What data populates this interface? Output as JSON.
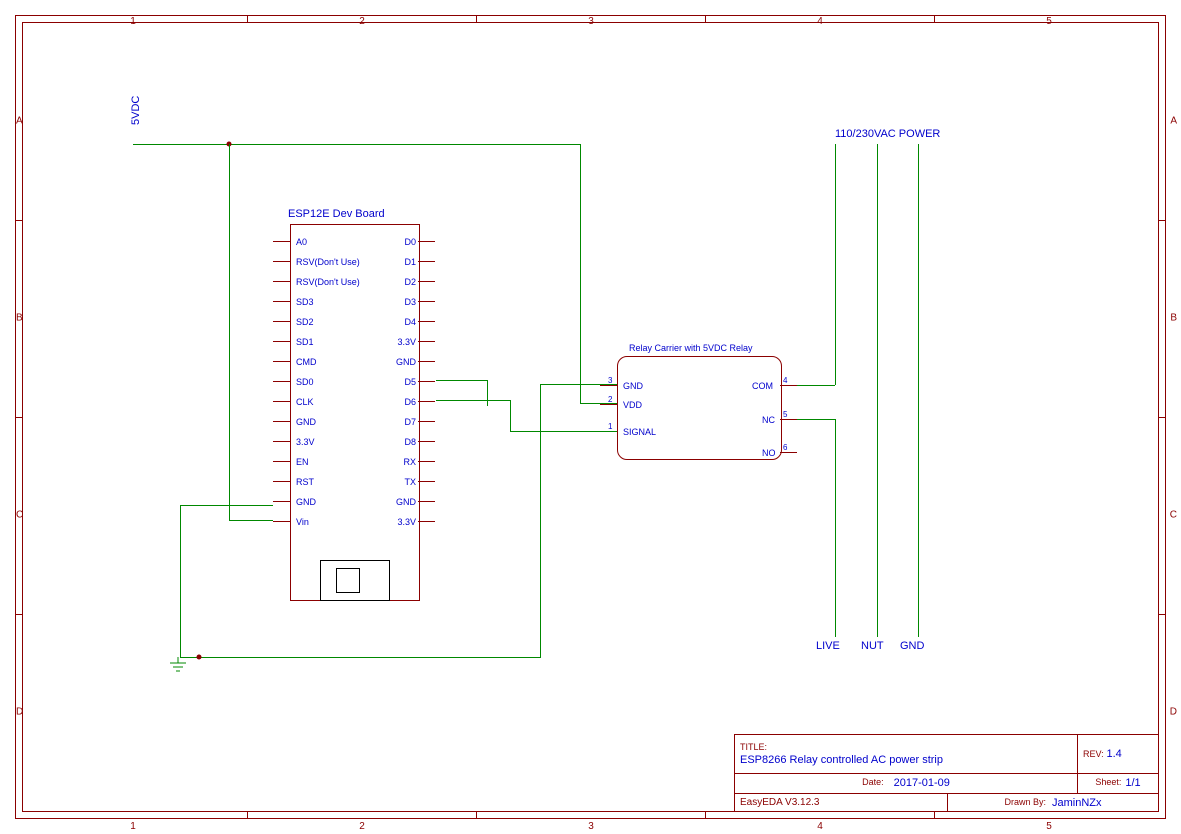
{
  "domain": "Diagram",
  "frame": {
    "cols": [
      "1",
      "2",
      "3",
      "4",
      "5"
    ],
    "rows": [
      "A",
      "B",
      "C",
      "D"
    ]
  },
  "titleblock": {
    "title_label": "TITLE:",
    "title": "ESP8266 Relay controlled AC power strip",
    "rev_label": "REV:",
    "rev": "1.4",
    "date_label": "Date:",
    "date": "2017-01-09",
    "sheet_label": "Sheet:",
    "sheet": "1/1",
    "software": "EasyEDA V3.12.3",
    "drawn_label": "Drawn By:",
    "drawn": "JaminNZx"
  },
  "nets": {
    "supply": "5VDC",
    "ac_power": "110/230VAC POWER",
    "live": "LIVE",
    "nut": "NUT",
    "gnd": "GND"
  },
  "esp": {
    "title": "ESP12E Dev Board",
    "left_pins": [
      "A0",
      "RSV(Don't Use)",
      "RSV(Don't Use)",
      "SD3",
      "SD2",
      "SD1",
      "CMD",
      "SD0",
      "CLK",
      "GND",
      "3.3V",
      "EN",
      "RST",
      "GND",
      "Vin"
    ],
    "right_pins": [
      "D0",
      "D1",
      "D2",
      "D3",
      "D4",
      "3.3V",
      "GND",
      "D5",
      "D6",
      "D7",
      "D8",
      "RX",
      "TX",
      "GND",
      "3.3V"
    ]
  },
  "relay": {
    "title": "Relay Carrier with 5VDC Relay",
    "pins_left": [
      "GND",
      "VDD",
      "SIGNAL"
    ],
    "nums_left": [
      "3",
      "2",
      "1"
    ],
    "pins_right": [
      "COM",
      "NC",
      "NO"
    ],
    "nums_right": [
      "4",
      "5",
      "6"
    ]
  },
  "chart_data": []
}
